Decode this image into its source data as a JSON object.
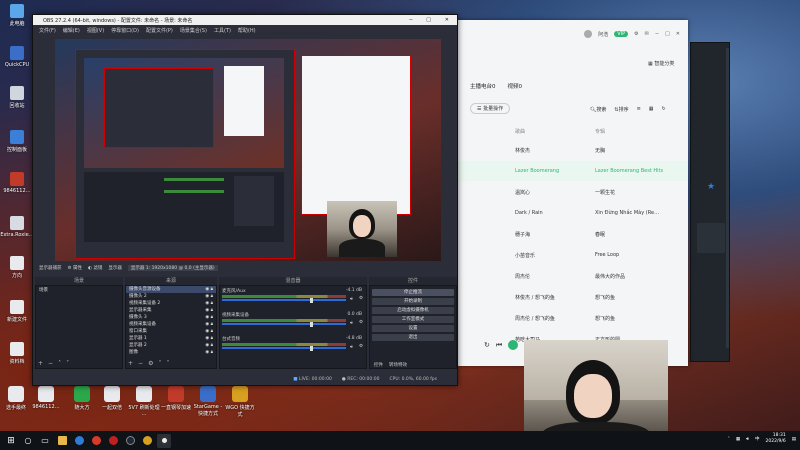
{
  "desktop_icons": [
    {
      "label": "此电脑",
      "color": "#5aa6e8"
    },
    {
      "label": "QuickCPU",
      "color": "#3a6ec8"
    },
    {
      "label": "回收站",
      "color": "#cfd6de"
    },
    {
      "label": "控制面板",
      "color": "#3b7fd8"
    },
    {
      "label": "9846112…",
      "color": "#c23b2a"
    },
    {
      "label": "Extra.Roxie…",
      "color": "#d8dce2"
    },
    {
      "label": "方向",
      "color": "#e8eaee"
    },
    {
      "label": "新建文件",
      "color": "#e8eaee"
    },
    {
      "label": "资料档",
      "color": "#e8eaee"
    }
  ],
  "bottom_icons": [
    {
      "label": "选手最终",
      "color": "#e8eaee"
    },
    {
      "label": "9846112…",
      "color": "#e8eaee"
    },
    {
      "label": "随大方",
      "color": "#2aa84a"
    },
    {
      "label": "一起双倍",
      "color": "#e8eaee"
    },
    {
      "label": "5V7 刷新处理 …",
      "color": "#e8eaee"
    },
    {
      "label": "一直钢琴加速",
      "color": "#c23b2a"
    },
    {
      "label": "StarGame - 快捷方式",
      "color": "#3a6ec8"
    },
    {
      "label": "WGO 快捷方式",
      "color": "#d8a020"
    }
  ],
  "obs": {
    "title": "OBS 27.2.4 (64-bit, windows) - 配置文件: 未命名 - 场景: 未命名",
    "menu": [
      "文件(F)",
      "编辑(E)",
      "视图(V)",
      "停靠窗口(D)",
      "配置文件(P)",
      "场景集合(S)",
      "工具(T)",
      "帮助(H)"
    ],
    "toolbar": [
      "显示器捕获",
      "属性",
      "滤镜",
      "显示器",
      "显示器 1: 1920x1080 @ 0,0 (主显示器)"
    ],
    "docks": {
      "scenes": "场景",
      "sources": "来源",
      "mixer": "混音器",
      "controls": "控件"
    },
    "scene_items": [
      "场景"
    ],
    "sources": [
      "摄像头音源设备",
      "摄像头 2",
      "视频采集设备 2",
      "显示器采集",
      "摄像头 3",
      "视频采集设备",
      "窗口采集",
      "显示器 1",
      "显示器 2",
      "图像"
    ],
    "mixer": [
      {
        "name": "麦克风/Aux",
        "db": "-4.1 dB"
      },
      {
        "name": "视频采集设备",
        "db": "0.0 dB"
      },
      {
        "name": "台式音频",
        "db": "-4.8 dB"
      }
    ],
    "controls": [
      "停止推流",
      "开始录制",
      "启动虚拟摄像机",
      "工作室模式",
      "设置",
      "退出"
    ],
    "bottom_tabs": [
      "控件",
      "转场特效"
    ],
    "status": {
      "live": "LIVE: 00:00:00",
      "rec": "REC: 00:00:00",
      "cpu": "CPU: 0.0%, 60.00 fps"
    }
  },
  "music": {
    "user": "阿浩",
    "vip": "VIP",
    "side_button": "智能分类",
    "tabs": [
      "主播电台0",
      "视频0"
    ],
    "batch_button": "批量操作",
    "search": "搜索",
    "sort": "排序",
    "col_song": "歌曲",
    "col_album": "专辑",
    "rows": [
      {
        "song": "林俊杰",
        "album": "无胸"
      },
      {
        "song": "Lazer Boomerang",
        "album": "Lazer Boomerang Best Hits",
        "active": true
      },
      {
        "song": "温岚心",
        "album": "一颗生花"
      },
      {
        "song": "Dark / Rain",
        "album": "Xin Đừng Nhắc Mày (Re…"
      },
      {
        "song": "穗子海",
        "album": "春眠"
      },
      {
        "song": "小苗音乐",
        "album": "Free Loop"
      },
      {
        "song": "周杰伦",
        "album": "最伟大的作品"
      },
      {
        "song": "林俊杰 / 想飞的鱼",
        "album": "想飞的鱼"
      },
      {
        "song": "周杰伦 / 想飞的鱼",
        "album": "想飞的鱼"
      },
      {
        "song": "苑晗大司马",
        "album": "正方形的圆"
      }
    ]
  },
  "taskbar": {
    "time": "18:31",
    "date": "2022/9/6",
    "lang": "中"
  },
  "colors": {
    "accent": "#2db673",
    "obs_bg": "#2b2e38",
    "red_border": "#cc0000"
  }
}
